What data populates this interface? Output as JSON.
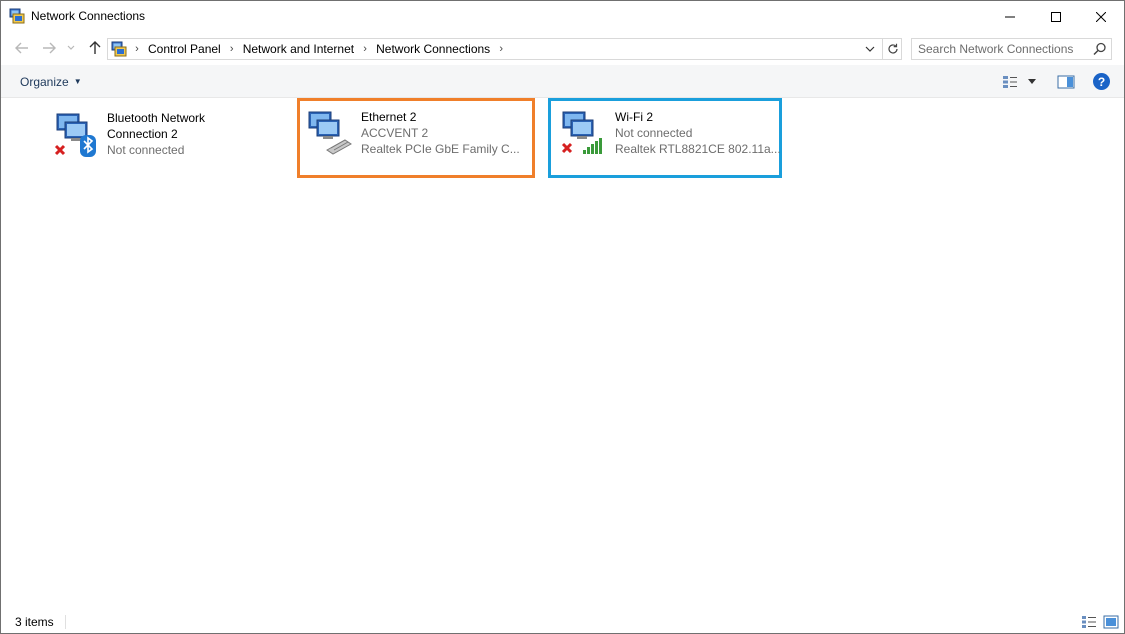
{
  "window": {
    "title": "Network Connections"
  },
  "address": {
    "crumbs": [
      "Control Panel",
      "Network and Internet",
      "Network Connections"
    ],
    "search_placeholder": "Search Network Connections"
  },
  "toolbar": {
    "organize_label": "Organize",
    "help_label": "?"
  },
  "connections": [
    {
      "name": "Bluetooth Network Connection 2",
      "name_line1": "Bluetooth Network",
      "name_line2": "Connection 2",
      "status": "Not connected",
      "device": ""
    },
    {
      "name": "Ethernet 2",
      "status": "ACCVENT 2",
      "device": "Realtek PCIe GbE Family C..."
    },
    {
      "name": "Wi-Fi 2",
      "status": "Not connected",
      "device": "Realtek RTL8821CE 802.11a..."
    }
  ],
  "statusbar": {
    "count": "3 items"
  },
  "colors": {
    "highlight_orange": "#f07f2a",
    "highlight_blue": "#1a9fdc",
    "help_blue": "#1a63c7"
  }
}
